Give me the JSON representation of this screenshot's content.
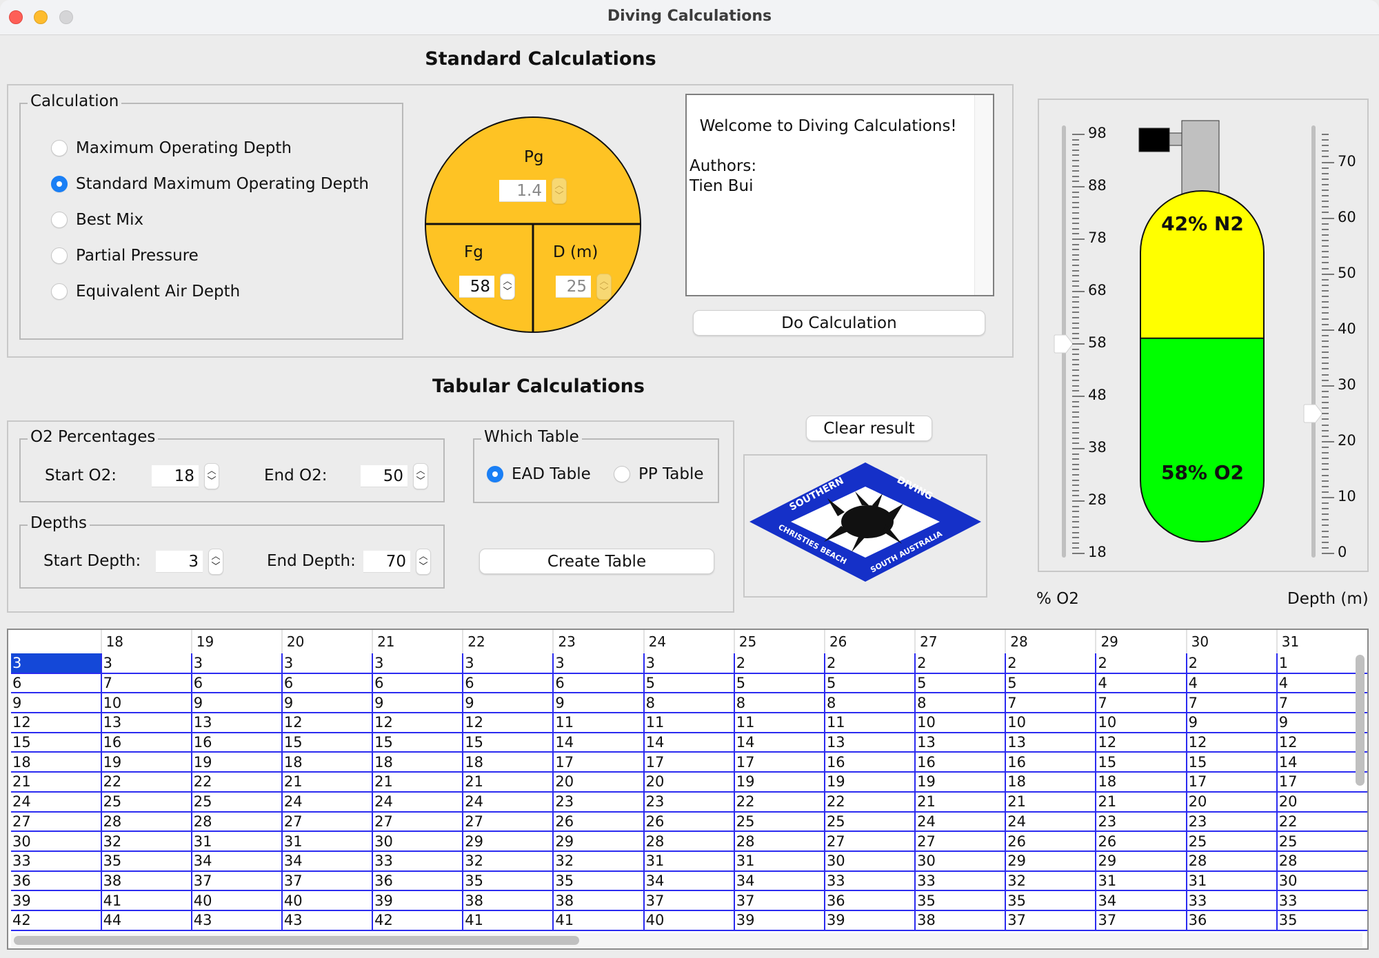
{
  "window": {
    "title": "Diving Calculations"
  },
  "standard": {
    "title": "Standard Calculations",
    "calculation_group": {
      "label": "Calculation",
      "options": [
        {
          "label": "Maximum Operating Depth",
          "selected": false
        },
        {
          "label": "Standard Maximum Operating Depth",
          "selected": true
        },
        {
          "label": "Best Mix",
          "selected": false
        },
        {
          "label": "Partial Pressure",
          "selected": false
        },
        {
          "label": "Equivalent Air Depth",
          "selected": false
        }
      ]
    },
    "circle": {
      "pg_label": "Pg",
      "pg_value": "1.4",
      "pg_enabled": false,
      "fg_label": "Fg",
      "fg_value": "58",
      "fg_enabled": true,
      "d_label": "D (m)",
      "d_value": "25",
      "d_enabled": false,
      "color": "#fec324"
    },
    "output": {
      "text": "Welcome to Diving Calculations!\n\nAuthors:\nTien Bui"
    },
    "do_calculation_label": "Do Calculation"
  },
  "tank": {
    "n2_label": "42% N2",
    "o2_label": "58% O2",
    "n2_percent": 42,
    "o2_percent": 58,
    "n2_color": "#ffff00",
    "o2_color": "#00ff00",
    "o2_slider": {
      "caption": "% O2",
      "min": 18,
      "max": 98,
      "value": 58,
      "labels": [
        "98",
        "88",
        "78",
        "68",
        "58",
        "48",
        "38",
        "28",
        "18"
      ]
    },
    "depth_slider": {
      "caption": "Depth (m)",
      "min": 0,
      "max": 75,
      "value": 25,
      "labels": [
        "70",
        "60",
        "50",
        "40",
        "30",
        "20",
        "10",
        "0"
      ]
    }
  },
  "tabular": {
    "title": "Tabular Calculations",
    "o2_group": {
      "label": "O2 Percentages",
      "start_label": "Start O2:",
      "start_value": "18",
      "end_label": "End O2:",
      "end_value": "50"
    },
    "depth_group": {
      "label": "Depths",
      "start_label": "Start Depth:",
      "start_value": "3",
      "end_label": "End Depth:",
      "end_value": "70"
    },
    "which_table": {
      "label": "Which Table",
      "options": [
        {
          "label": "EAD Table",
          "selected": true
        },
        {
          "label": "PP Table",
          "selected": false
        }
      ]
    },
    "create_table_label": "Create Table",
    "clear_result_label": "Clear result",
    "logo": {
      "top_left": "SOUTHERN",
      "top_right": "DIVING",
      "bottom_left": "CHRISTIES BEACH",
      "bottom_right": "SOUTH AUSTRALIA",
      "color": "#1530c8"
    }
  },
  "result_table": {
    "headers": [
      "",
      "18",
      "19",
      "20",
      "21",
      "22",
      "23",
      "24",
      "25",
      "26",
      "27",
      "28",
      "29",
      "30",
      "31"
    ],
    "rows": [
      [
        "3",
        "3",
        "3",
        "3",
        "3",
        "3",
        "3",
        "3",
        "2",
        "2",
        "2",
        "2",
        "2",
        "2",
        "1"
      ],
      [
        "6",
        "7",
        "6",
        "6",
        "6",
        "6",
        "6",
        "5",
        "5",
        "5",
        "5",
        "5",
        "4",
        "4",
        "4"
      ],
      [
        "9",
        "10",
        "9",
        "9",
        "9",
        "9",
        "9",
        "8",
        "8",
        "8",
        "8",
        "7",
        "7",
        "7",
        "7"
      ],
      [
        "12",
        "13",
        "13",
        "12",
        "12",
        "12",
        "11",
        "11",
        "11",
        "11",
        "10",
        "10",
        "10",
        "9",
        "9"
      ],
      [
        "15",
        "16",
        "16",
        "15",
        "15",
        "15",
        "14",
        "14",
        "14",
        "13",
        "13",
        "13",
        "12",
        "12",
        "12"
      ],
      [
        "18",
        "19",
        "19",
        "18",
        "18",
        "18",
        "17",
        "17",
        "17",
        "16",
        "16",
        "16",
        "15",
        "15",
        "14"
      ],
      [
        "21",
        "22",
        "22",
        "21",
        "21",
        "21",
        "20",
        "20",
        "19",
        "19",
        "19",
        "18",
        "18",
        "17",
        "17"
      ],
      [
        "24",
        "25",
        "25",
        "24",
        "24",
        "24",
        "23",
        "23",
        "22",
        "22",
        "21",
        "21",
        "21",
        "20",
        "20"
      ],
      [
        "27",
        "28",
        "28",
        "27",
        "27",
        "27",
        "26",
        "26",
        "25",
        "25",
        "24",
        "24",
        "23",
        "23",
        "22"
      ],
      [
        "30",
        "32",
        "31",
        "31",
        "30",
        "29",
        "29",
        "28",
        "28",
        "27",
        "27",
        "26",
        "26",
        "25",
        "25"
      ],
      [
        "33",
        "35",
        "34",
        "34",
        "33",
        "32",
        "32",
        "31",
        "31",
        "30",
        "30",
        "29",
        "29",
        "28",
        "28"
      ],
      [
        "36",
        "38",
        "37",
        "37",
        "36",
        "35",
        "35",
        "34",
        "34",
        "33",
        "33",
        "32",
        "31",
        "31",
        "30"
      ],
      [
        "39",
        "41",
        "40",
        "40",
        "39",
        "38",
        "38",
        "37",
        "37",
        "36",
        "35",
        "35",
        "34",
        "33",
        "33"
      ],
      [
        "42",
        "44",
        "43",
        "43",
        "42",
        "41",
        "41",
        "40",
        "39",
        "39",
        "38",
        "37",
        "37",
        "36",
        "35"
      ]
    ],
    "selected_cell": [
      0,
      0
    ]
  }
}
